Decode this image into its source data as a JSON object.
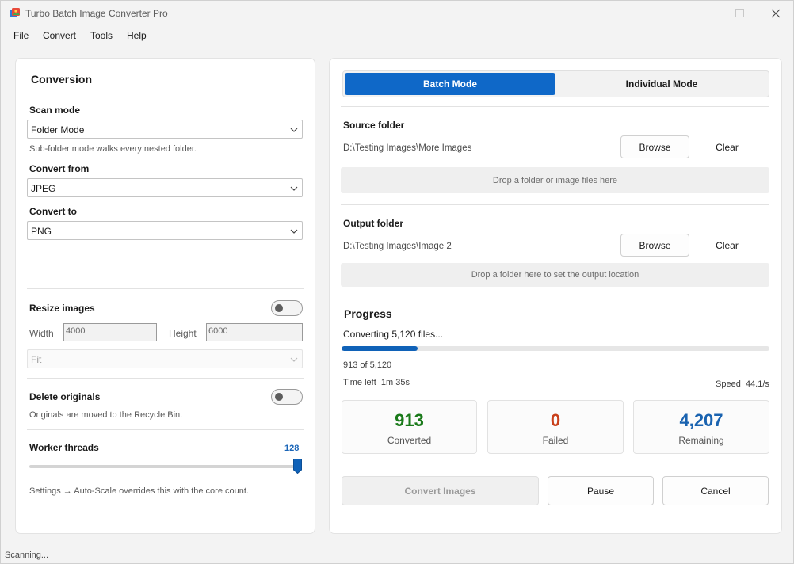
{
  "window": {
    "title": "Turbo Batch Image Converter Pro"
  },
  "menu": [
    "File",
    "Convert",
    "Tools",
    "Help"
  ],
  "conversion": {
    "title": "Conversion",
    "scan_mode_label": "Scan mode",
    "scan_mode_value": "Folder Mode",
    "scan_mode_hint": "Sub-folder mode walks every nested folder.",
    "convert_from_label": "Convert from",
    "convert_from_value": "JPEG",
    "convert_to_label": "Convert to",
    "convert_to_value": "PNG",
    "resize_label": "Resize images",
    "resize_enabled": false,
    "width_label": "Width",
    "width_value": "4000",
    "height_label": "Height",
    "height_value": "6000",
    "fit_value": "Fit",
    "delete_label": "Delete originals",
    "delete_enabled": false,
    "delete_hint": "Originals are moved to the Recycle Bin.",
    "threads_label": "Worker threads",
    "threads_value": "128",
    "threads_hint": "Settings → Auto-Scale overrides this with the core count."
  },
  "modes": {
    "batch": "Batch Mode",
    "individual": "Individual Mode",
    "active": "batch"
  },
  "source": {
    "label": "Source folder",
    "path": "D:\\Testing Images\\More Images",
    "browse": "Browse",
    "clear": "Clear",
    "drop_hint": "Drop a folder or image files here"
  },
  "output": {
    "label": "Output folder",
    "path": "D:\\Testing Images\\Image 2",
    "browse": "Browse",
    "clear": "Clear",
    "drop_hint": "Drop a folder here to set the output location"
  },
  "progress": {
    "title": "Progress",
    "status": "Converting 5,120 files...",
    "fraction": 0.178,
    "count_text": "913 of 5,120",
    "time_left_label": "Time left",
    "time_left_value": "1m 35s",
    "speed_label": "Speed",
    "speed_value": "44.1/s"
  },
  "stats": {
    "converted_value": "913",
    "converted_label": "Converted",
    "converted_color": "#1a7a1a",
    "failed_value": "0",
    "failed_label": "Failed",
    "failed_color": "#c9401b",
    "remaining_value": "4,207",
    "remaining_label": "Remaining",
    "remaining_color": "#1a63b0"
  },
  "actions": {
    "convert": "Convert Images",
    "pause": "Pause",
    "cancel": "Cancel"
  },
  "statusbar": {
    "text": "Scanning..."
  }
}
